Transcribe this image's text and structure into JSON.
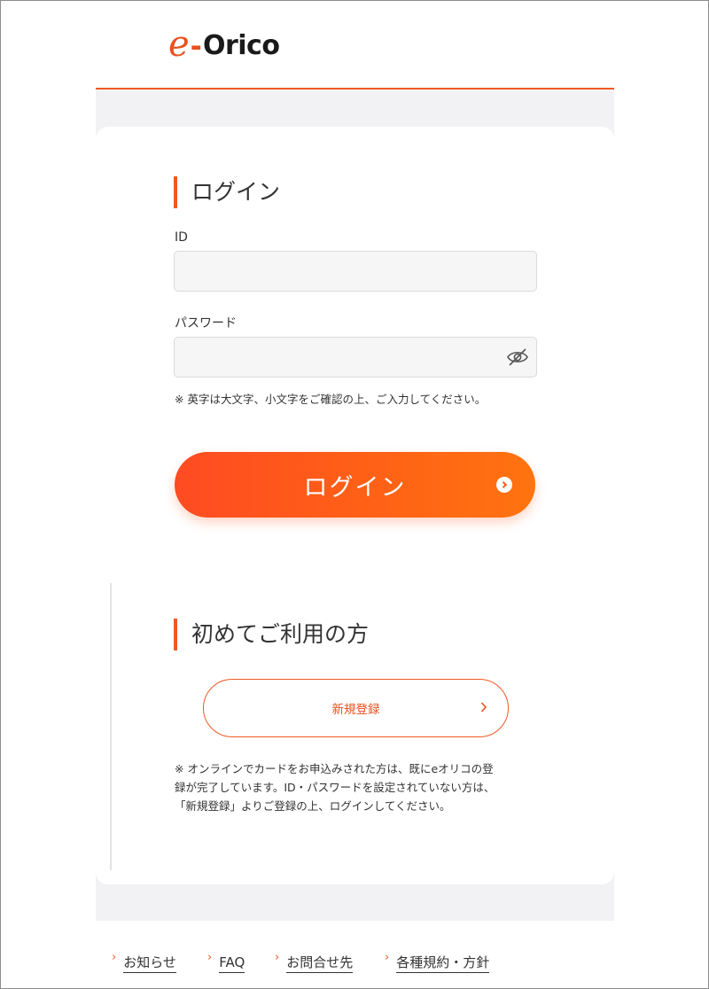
{
  "header": {
    "logo_e": "e",
    "logo_dash": "-",
    "logo_text": "Orico"
  },
  "login": {
    "title": "ログイン",
    "id_label": "ID",
    "id_value": "",
    "password_label": "パスワード",
    "password_value": "",
    "note": "※ 英字は大文字、小文字をご確認の上、ご入力してください。",
    "button_label": "ログイン"
  },
  "first_time": {
    "title": "初めてご利用の方",
    "register_label": "新規登録",
    "note_lines": [
      "※ オンラインでカードをお申込みされた方は、既にeオリコの登",
      "録が完了しています。ID・パスワードを設定されていない方は、",
      "「新規登録」よりご登録の上、ログインしてください。"
    ]
  },
  "footer": {
    "links": [
      {
        "label": "お知らせ"
      },
      {
        "label": "FAQ"
      },
      {
        "label": "お問合せ先"
      },
      {
        "label": "各種規約・方針"
      }
    ]
  },
  "colors": {
    "accent": "#ee5a24",
    "button_gradient_start": "#ff4b22",
    "button_gradient_end": "#ff7310",
    "background_gray": "#f2f2f4"
  },
  "icons": {
    "password_toggle": "eye-slash-icon",
    "login_arrow": "chevron-right-circle-icon",
    "register_arrow": "chevron-right-icon",
    "footer_arrow": "chevron-right-icon"
  }
}
